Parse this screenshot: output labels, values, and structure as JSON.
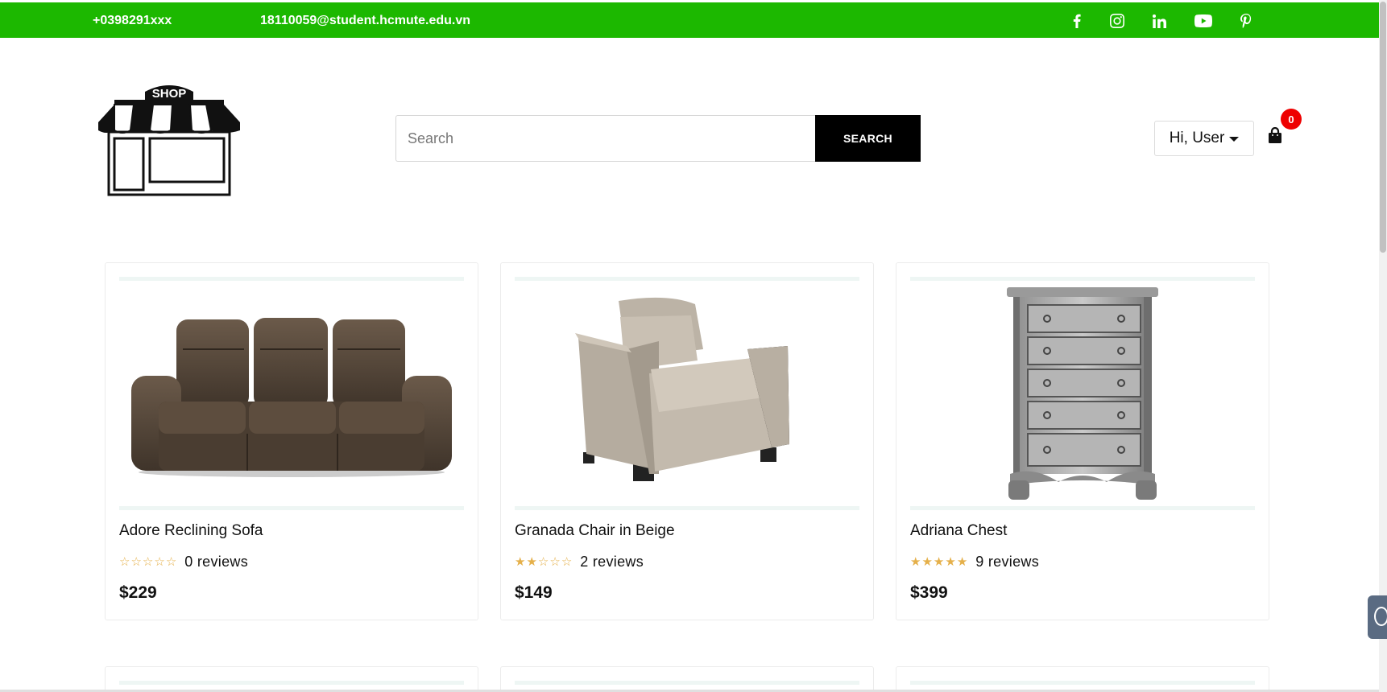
{
  "topbar": {
    "phone": "+0398291xxx",
    "email": "18110059@student.hcmute.edu.vn",
    "background": "#1cb800",
    "social": [
      "facebook-icon",
      "instagram-icon",
      "linkedin-icon",
      "youtube-icon",
      "pinterest-icon"
    ]
  },
  "header": {
    "logo_text": "SHOP",
    "search": {
      "placeholder": "Search",
      "button_label": "SEARCH"
    },
    "user_menu_label": "Hi, User",
    "cart_count": "0"
  },
  "products": [
    {
      "name": "Adore Reclining Sofa",
      "stars": 0,
      "reviews": "0 reviews",
      "price": "$229",
      "image": "sofa"
    },
    {
      "name": "Granada Chair in Beige",
      "stars": 2,
      "reviews": "2 reviews",
      "price": "$149",
      "image": "armchair"
    },
    {
      "name": "Adriana Chest",
      "stars": 5,
      "reviews": "9 reviews",
      "price": "$399",
      "image": "chest"
    }
  ],
  "colors": {
    "accent_green": "#1cb800",
    "star": "#e5b04a",
    "badge": "#ee0000"
  }
}
